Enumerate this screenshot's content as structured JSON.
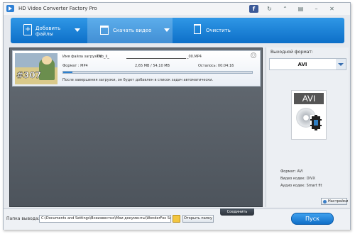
{
  "app": {
    "title": "HD Video Converter Factory Pro"
  },
  "titlebar": {
    "buttons": [
      {
        "icon": "facebook-icon",
        "glyph": "f"
      },
      {
        "icon": "refresh-icon",
        "glyph": "↻"
      },
      {
        "icon": "update-icon",
        "glyph": "⌃"
      },
      {
        "icon": "menu-icon",
        "glyph": "▤"
      },
      {
        "icon": "minimize-icon",
        "glyph": "–"
      },
      {
        "icon": "close-icon",
        "glyph": "✕"
      }
    ]
  },
  "toolbar": {
    "add_files_line1": "Добавить",
    "add_files_line2": "файлы",
    "download_video": "Скачать видео",
    "clear": "Очистить"
  },
  "task": {
    "thumbnail_number": "#307",
    "name_label": "Имя файла загрузки:",
    "name_value": "TNb_ii_",
    "name_ext": "_00.MP4",
    "format": "Формат : MP4",
    "size": "2,65 MB / 54,10 MB",
    "remaining": "Осталось: 00:04:16",
    "progress": 0.05,
    "note": "После завершения загрузки, он будет добавлен в список задач автоматически."
  },
  "output_panel": {
    "title": "Выходной формат:",
    "selected_format": "AVI",
    "format_icon_text": "AVI",
    "format_info": "Формат: AVI",
    "video_codec": "Видео кодек: DIVX",
    "audio_codec": "Аудио кодек: Smart fit",
    "settings_button": "Настройки"
  },
  "bottombar": {
    "output_folder_label": "Папка вывода:",
    "output_path": "C:\\Documents and Settings\\Всеизвестно\\Мои документы\\WonderFox Soft\\",
    "open_folder_button": "Открыть папку",
    "merge_button": "Соединить",
    "run_button": "Пуск"
  }
}
